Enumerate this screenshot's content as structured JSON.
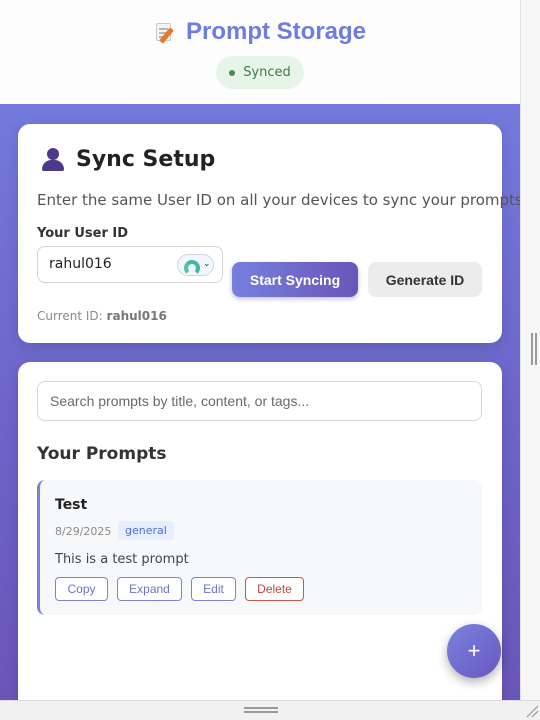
{
  "header": {
    "title": "Prompt Storage",
    "title_icon": "memo-pencil-icon",
    "status": "Synced"
  },
  "sync_setup": {
    "title": "Sync Setup",
    "icon": "user-silhouette-icon",
    "description": "Enter the same User ID on all your devices to sync your prompts",
    "field_label": "Your User ID",
    "user_id_value": "rahul016",
    "start_button": "Start Syncing",
    "generate_button": "Generate ID",
    "current_id_label": "Current ID:",
    "current_id_value": "rahul016"
  },
  "prompts": {
    "search_placeholder": "Search prompts by title, content, or tags...",
    "section_title": "Your Prompts",
    "items": [
      {
        "title": "Test",
        "date": "8/29/2025",
        "tag": "general",
        "content": "This is a test prompt",
        "actions": {
          "copy": "Copy",
          "expand": "Expand",
          "edit": "Edit",
          "delete": "Delete"
        }
      }
    ]
  },
  "fab": {
    "label": "+"
  },
  "colors": {
    "accent": "#6f7ce0",
    "gradient_start": "#7479dc",
    "gradient_end": "#6a56b8",
    "status_bg": "#e7f4e8",
    "delete": "#c0463b"
  }
}
